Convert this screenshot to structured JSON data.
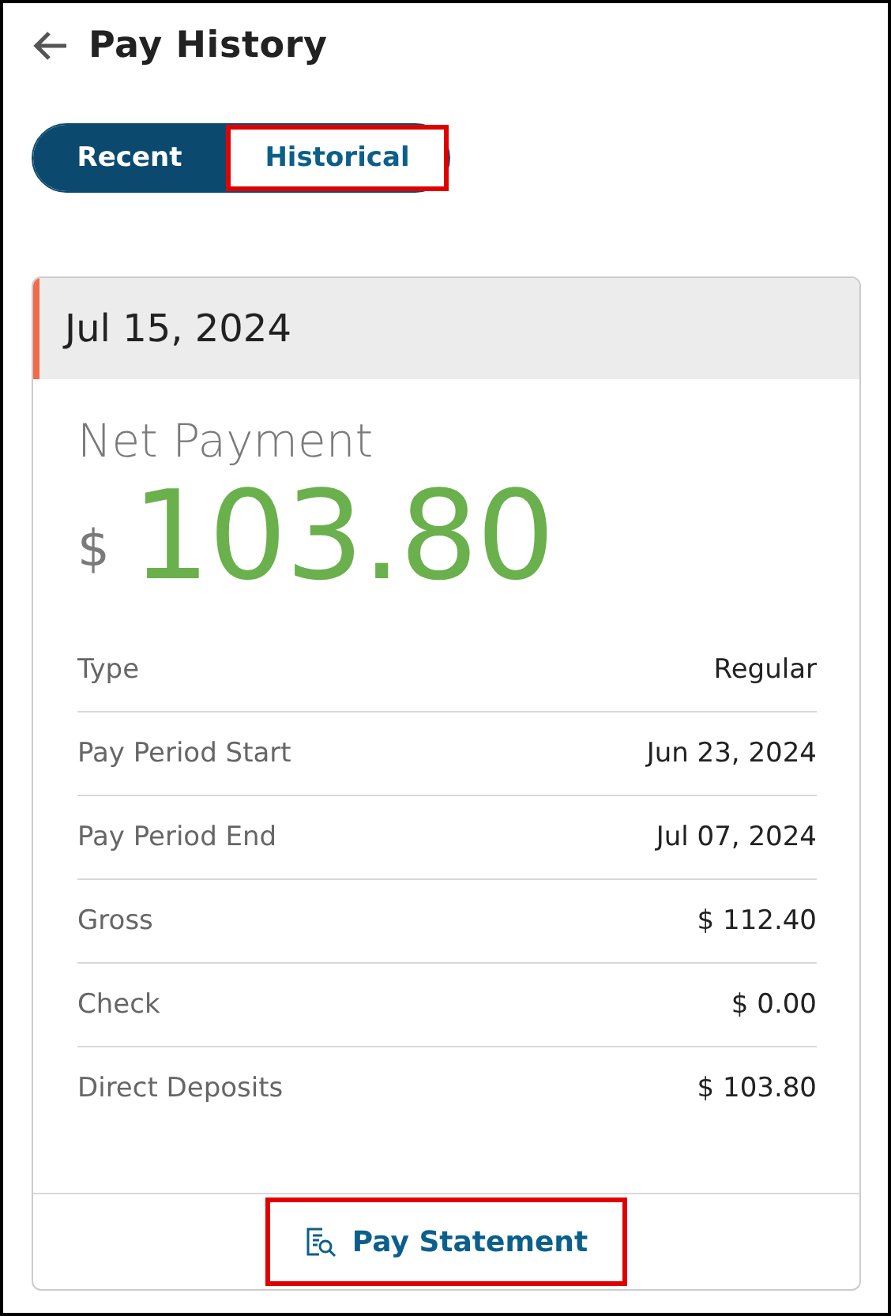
{
  "header": {
    "title": "Pay History"
  },
  "tabs": [
    {
      "label": "Recent",
      "selected": true,
      "highlighted": false
    },
    {
      "label": "Historical",
      "selected": false,
      "highlighted": true
    }
  ],
  "payment": {
    "date": "Jul 15, 2024",
    "net_label": "Net Payment",
    "currency": "$",
    "amount": "103.80",
    "details": [
      {
        "label": "Type",
        "value": "Regular"
      },
      {
        "label": "Pay Period Start",
        "value": "Jun 23, 2024"
      },
      {
        "label": "Pay Period End",
        "value": "Jul 07, 2024"
      },
      {
        "label": "Gross",
        "value": "$ 112.40"
      },
      {
        "label": "Check",
        "value": "$ 0.00"
      },
      {
        "label": "Direct Deposits",
        "value": "$ 103.80"
      }
    ],
    "statement_button": {
      "label": "Pay Statement",
      "highlighted": true
    }
  }
}
